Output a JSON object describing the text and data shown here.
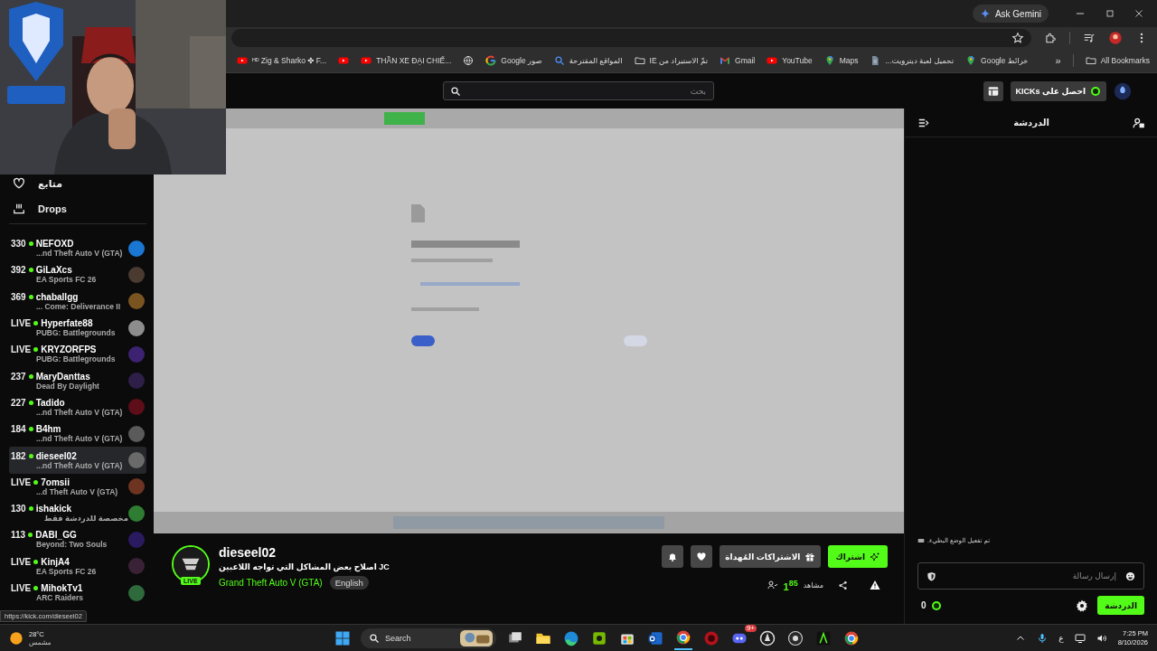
{
  "browser": {
    "gemini_button": "Ask Gemini",
    "bookmarks": [
      {
        "label": "ᴴᴰ Zig & Sharko ✤ F...",
        "kind": "youtube"
      },
      {
        "kind": "youtube"
      },
      {
        "label": "THẦN XE ĐẠI CHIẾ...",
        "kind": "youtube"
      },
      {
        "kind": "globe"
      },
      {
        "label": "Google صور",
        "kind": "google"
      },
      {
        "label": "المواقع المقترحة",
        "kind": "search"
      },
      {
        "label": "تمّ الاستيراد من IE",
        "kind": "folder"
      },
      {
        "label": "Gmail",
        "kind": "gmail"
      },
      {
        "label": "YouTube",
        "kind": "youtube"
      },
      {
        "label": "Maps",
        "kind": "maps"
      },
      {
        "label": "تحميل لعبة ديترويت...",
        "kind": "file"
      },
      {
        "label": "Google خرائط",
        "kind": "maps"
      }
    ],
    "more_bookmarks": "»",
    "all_bookmarks": "All Bookmarks"
  },
  "header": {
    "search_placeholder": "بحث",
    "kicks_button": "احصل على KICKs"
  },
  "sidebar": {
    "nav": [
      {
        "label": "متابع",
        "kind": "heart"
      },
      {
        "label": "Drops",
        "kind": "drops"
      }
    ],
    "channels": [
      {
        "viewers": "330",
        "name": "NEFOXD",
        "game": "...nd Theft Auto V (GTA)",
        "selected": false
      },
      {
        "viewers": "392",
        "name": "GiLaXcs",
        "game": "EA Sports FC 26",
        "selected": false
      },
      {
        "viewers": "369",
        "name": "chaballgg",
        "game": "... Come: Deliverance II",
        "selected": false
      },
      {
        "viewers": "LIVE",
        "name": "Hyperfate88",
        "game": "PUBG: Battlegrounds",
        "selected": false
      },
      {
        "viewers": "LIVE",
        "name": "KRYZORFPS",
        "game": "PUBG: Battlegrounds",
        "selected": false
      },
      {
        "viewers": "237",
        "name": "MaryDanttas",
        "game": "Dead By Daylight",
        "selected": false
      },
      {
        "viewers": "227",
        "name": "Tadido",
        "game": "...nd Theft Auto V (GTA)",
        "selected": false
      },
      {
        "viewers": "184",
        "name": "B4hm",
        "game": "...nd Theft Auto V (GTA)",
        "selected": false
      },
      {
        "viewers": "182",
        "name": "dieseel02",
        "game": "...nd Theft Auto V (GTA)",
        "selected": true
      },
      {
        "viewers": "LIVE",
        "name": "7omsii",
        "game": "...d Theft Auto V (GTA)",
        "selected": false
      },
      {
        "viewers": "130",
        "name": "ishakick",
        "game": "مخصصة للدردشة فقط",
        "selected": false
      },
      {
        "viewers": "113",
        "name": "DABI_GG",
        "game": "Beyond: Two Souls",
        "selected": false
      },
      {
        "viewers": "LIVE",
        "name": "KinjA4",
        "game": "EA Sports FC 26",
        "selected": false
      },
      {
        "viewers": "LIVE",
        "name": "MihokTv1",
        "game": "ARC Raiders",
        "selected": false
      }
    ]
  },
  "stream": {
    "live_badge": "LIVE",
    "channel": "dieseel02",
    "title": "JC اصلاح بعض المشاكل التي تواجه اللاعبين",
    "game": "Grand Theft Auto V (GTA)",
    "tag": "English",
    "gift_button": "الاشتراكات المُهداة",
    "subscribe_button": "اشتراك",
    "viewers": "1$^{85}$",
    "viewers_label": "مشاهد"
  },
  "chat": {
    "title": "الدردشة",
    "notice": "تم تفعيل الوضع البطيء.",
    "input_placeholder": "إرسال رسالة",
    "kicks_balance": "0",
    "chat_button": "الدردشة"
  },
  "status_url": "https://kick.com/dieseel02",
  "taskbar": {
    "temperature": "28°C",
    "weather": "مشمس",
    "search": "Search",
    "badge": "9+",
    "keyboard_language": "ع",
    "time": "7:25 PM",
    "date": "8/10/2026"
  }
}
